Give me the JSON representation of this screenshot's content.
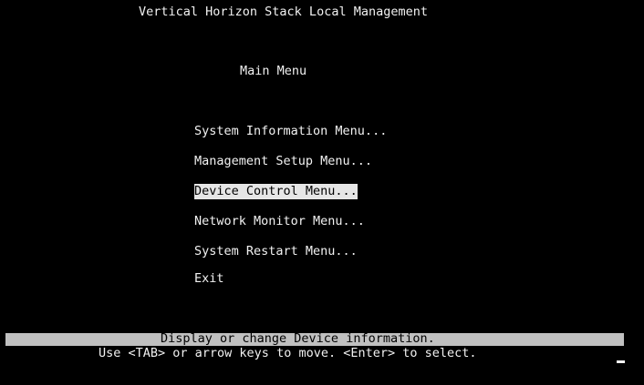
{
  "app_title": "Vertical Horizon Stack Local Management",
  "menu_title": "Main Menu",
  "menu_items": [
    {
      "label": "System Information Menu..."
    },
    {
      "label": "Management Setup Menu..."
    },
    {
      "label": "Device Control Menu..."
    },
    {
      "label": "Network Monitor Menu..."
    },
    {
      "label": "System Restart Menu..."
    },
    {
      "label": "Exit"
    }
  ],
  "selected_item": "Device Control Menu...",
  "status_message": "Display or change Device information.",
  "help_text": "Use <TAB> or arrow keys to move. <Enter> to select."
}
